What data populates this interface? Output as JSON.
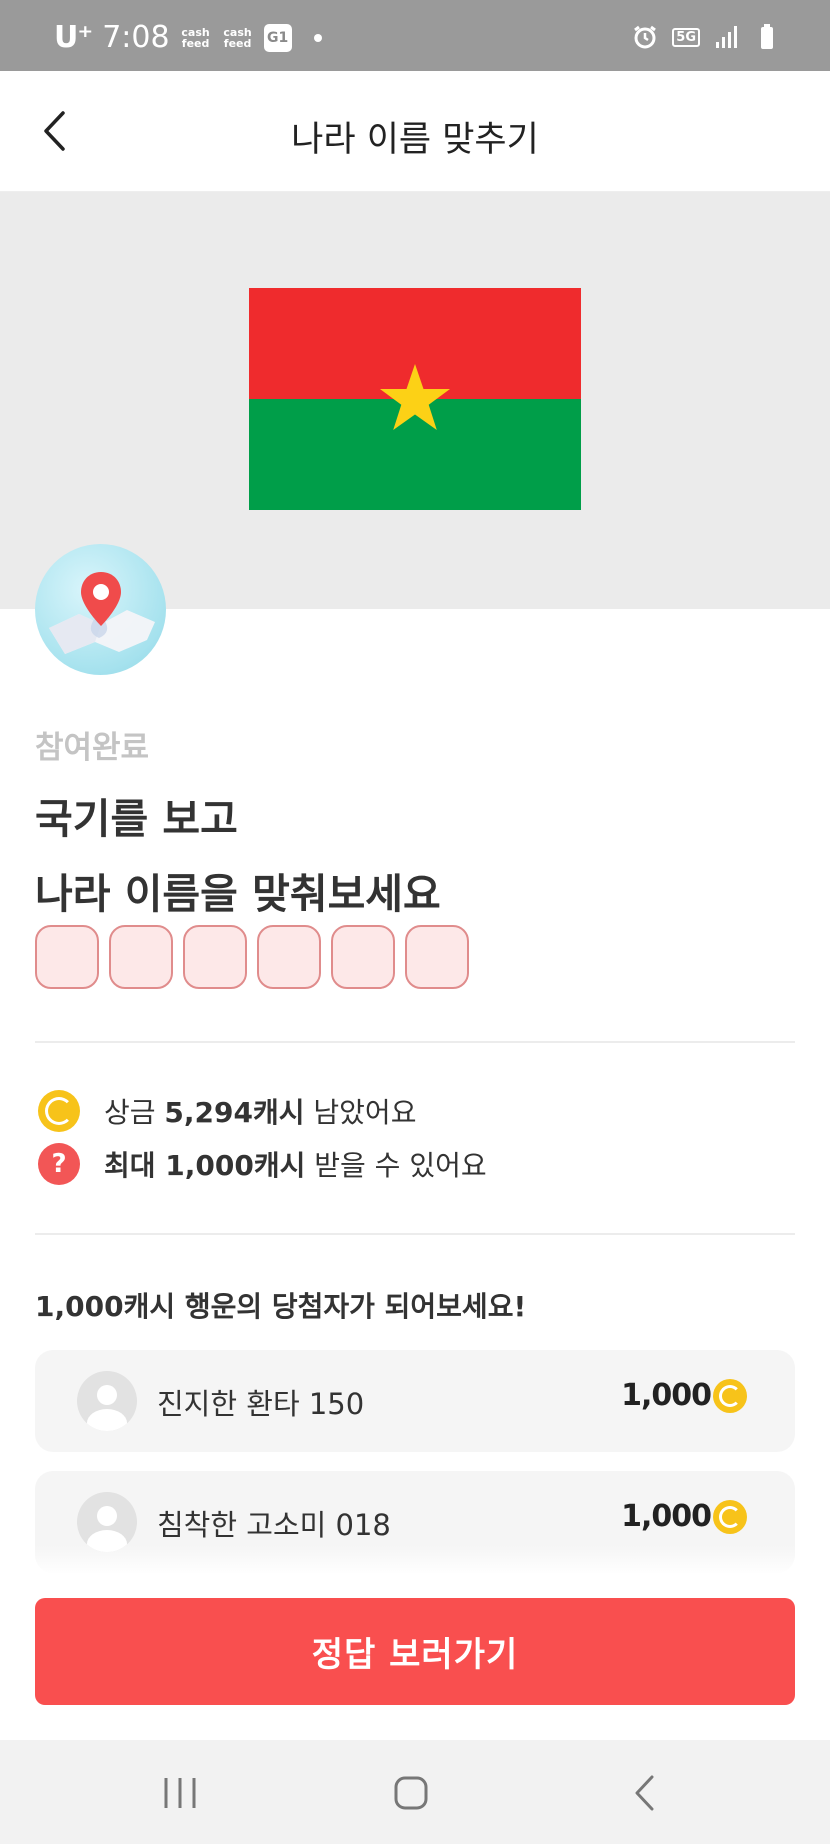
{
  "status_bar": {
    "carrier": "U⁺",
    "time": "7:08",
    "notif_1": "cash\nfeed",
    "notif_2": "cash\nfeed",
    "app_badge": "G1",
    "network": "5G",
    "icons": [
      "alarm-icon",
      "5g-icon",
      "signal-icon",
      "battery-icon"
    ]
  },
  "header": {
    "title": "나라 이름 맞추기",
    "back_icon": "chevron-left-icon"
  },
  "banner": {
    "flag_colors": {
      "top": "#ef2b2d",
      "bottom": "#009e49",
      "star": "#fcd116"
    },
    "background": "#ebebeb"
  },
  "quiz": {
    "status": "참여완료",
    "question_line1": "국기를 보고",
    "question_line2": "나라 이름을 맞춰보세요",
    "answer_box_count": 6
  },
  "info": {
    "prize_prefix": "상금 ",
    "prize_amount": "5,294캐시",
    "prize_suffix": " 남았어요",
    "max_prefix": "최대 1,000캐시",
    "max_suffix": " 받을 수 있어요"
  },
  "winners": {
    "title": "1,000캐시 행운의 당첨자가 되어보세요!",
    "items": [
      {
        "name": "진지한 환타 150",
        "amount": "1,000"
      },
      {
        "name": "침착한 고소미 018",
        "amount": "1,000"
      }
    ]
  },
  "cta": {
    "label": "정답 보러가기"
  },
  "colors": {
    "accent": "#f94f4f",
    "coin": "#f7c31a"
  }
}
